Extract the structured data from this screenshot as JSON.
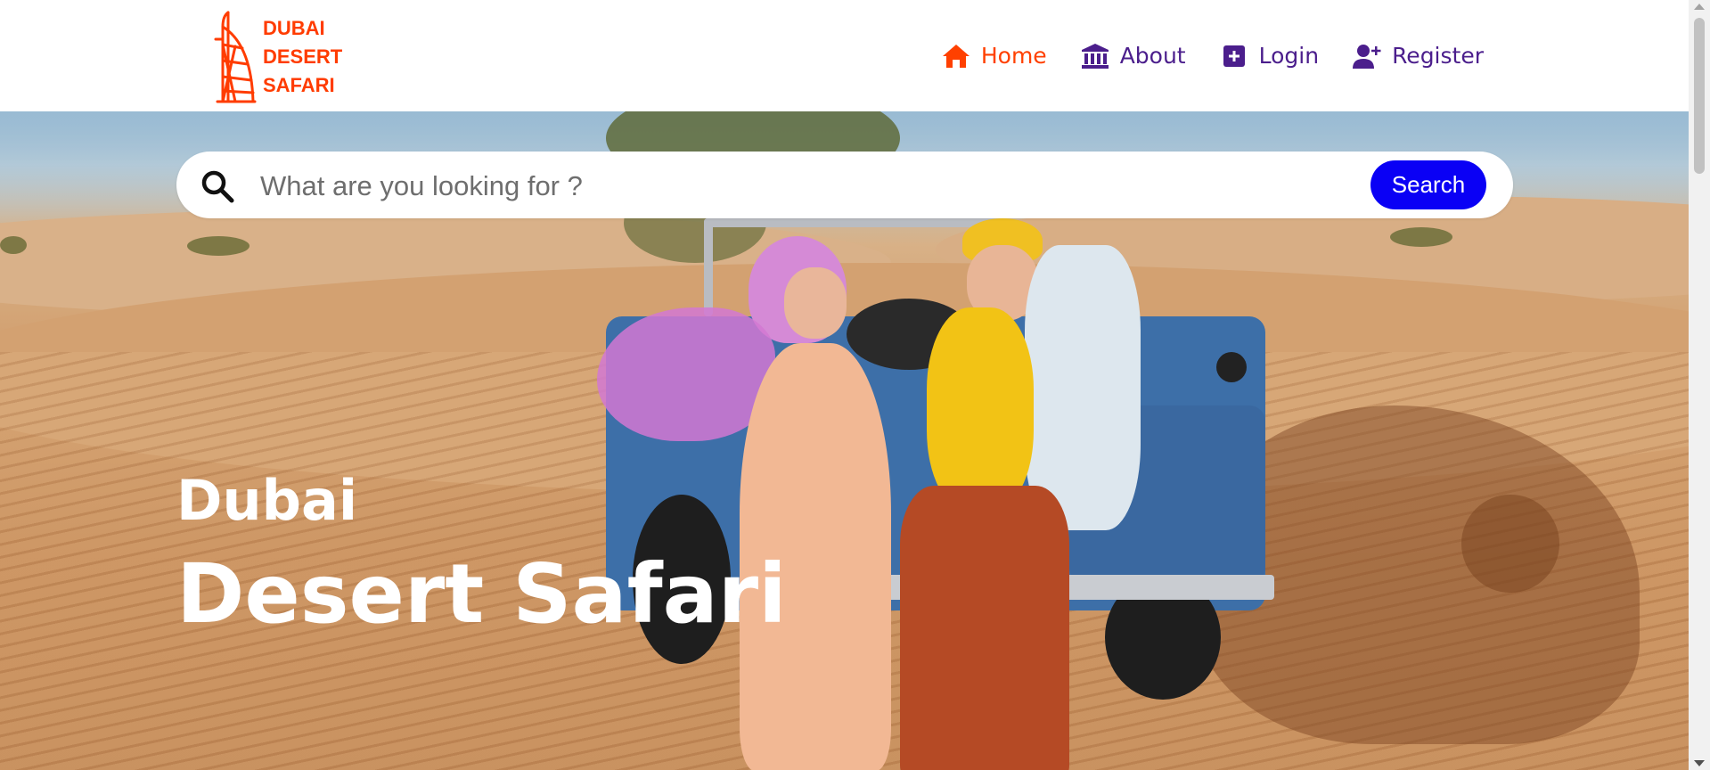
{
  "brand": {
    "lines": [
      "DUBAI",
      "DESERT",
      "SAFARI"
    ],
    "color": "#ff3c00",
    "logo_icon": "burj-al-arab-icon"
  },
  "nav": {
    "items": [
      {
        "label": "Home",
        "icon": "home-icon",
        "active": true
      },
      {
        "label": "About",
        "icon": "bank-icon",
        "active": false
      },
      {
        "label": "Login",
        "icon": "plus-square-icon",
        "active": false
      },
      {
        "label": "Register",
        "icon": "user-plus-icon",
        "active": false
      }
    ],
    "active_color": "#ff4000",
    "color": "#4b1e8c"
  },
  "search": {
    "placeholder": "What are you looking for ?",
    "value": "",
    "button_label": "Search",
    "button_color": "#0a00f5"
  },
  "hero": {
    "line1": "Dubai",
    "line2": "Desert Safari"
  }
}
